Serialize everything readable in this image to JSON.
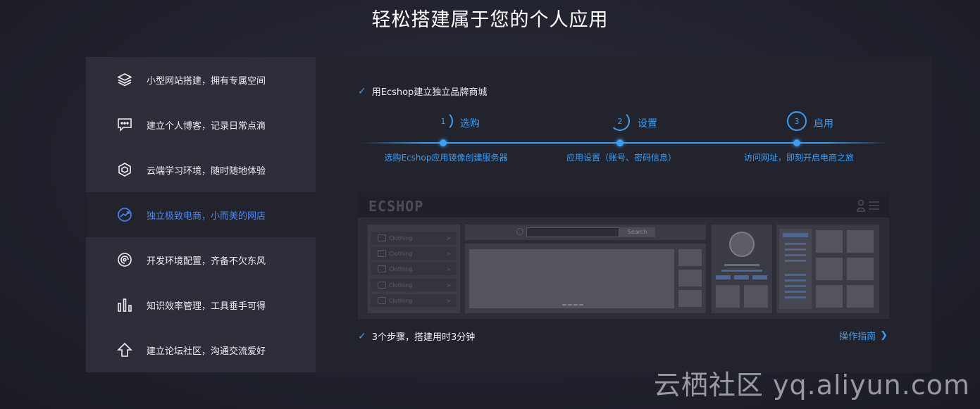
{
  "page": {
    "title": "轻松搭建属于您的个人应用"
  },
  "sidebar": {
    "items": [
      {
        "label": "小型网站搭建，拥有专属空间",
        "icon": "layers-icon"
      },
      {
        "label": "建立个人博客，记录日常点滴",
        "icon": "chat-bubble-icon"
      },
      {
        "label": "云端学习环境，随时随地体验",
        "icon": "hexagon-icon"
      },
      {
        "label": "独立极致电商，小而美的网店",
        "icon": "trend-circle-icon",
        "active": true
      },
      {
        "label": "开发环境配置，齐备不欠东风",
        "icon": "spiral-icon"
      },
      {
        "label": "知识效率管理，工具垂手可得",
        "icon": "bar-chart-icon"
      },
      {
        "label": "建立论坛社区，沟通交流爱好",
        "icon": "up-arrow-icon"
      }
    ]
  },
  "panel": {
    "headline": "用Ecshop建立独立品牌商城",
    "steps": [
      {
        "num": "1",
        "label": "选购",
        "desc": "选购Ecshop应用镜像创建服务器"
      },
      {
        "num": "2",
        "label": "设置",
        "desc": "应用设置（账号、密码信息）"
      },
      {
        "num": "3",
        "label": "启用",
        "desc": "访问网址，即刻开启电商之旅"
      }
    ],
    "footer_note": "3个步骤，搭建用时3分钟",
    "guide_link": "操作指南",
    "mockup": {
      "logo": "ECSHOP",
      "search_button": "Search",
      "categories": [
        "Clothing",
        "Clothing",
        "Clothing",
        "Clothing",
        "Clothing"
      ]
    }
  },
  "watermark": "云栖社区 yq.aliyun.com",
  "colors": {
    "accent": "#3d9df2",
    "active": "#4d87f5",
    "sidebar_bg": "#2d2e3a",
    "panel_bg": "#22232d"
  }
}
